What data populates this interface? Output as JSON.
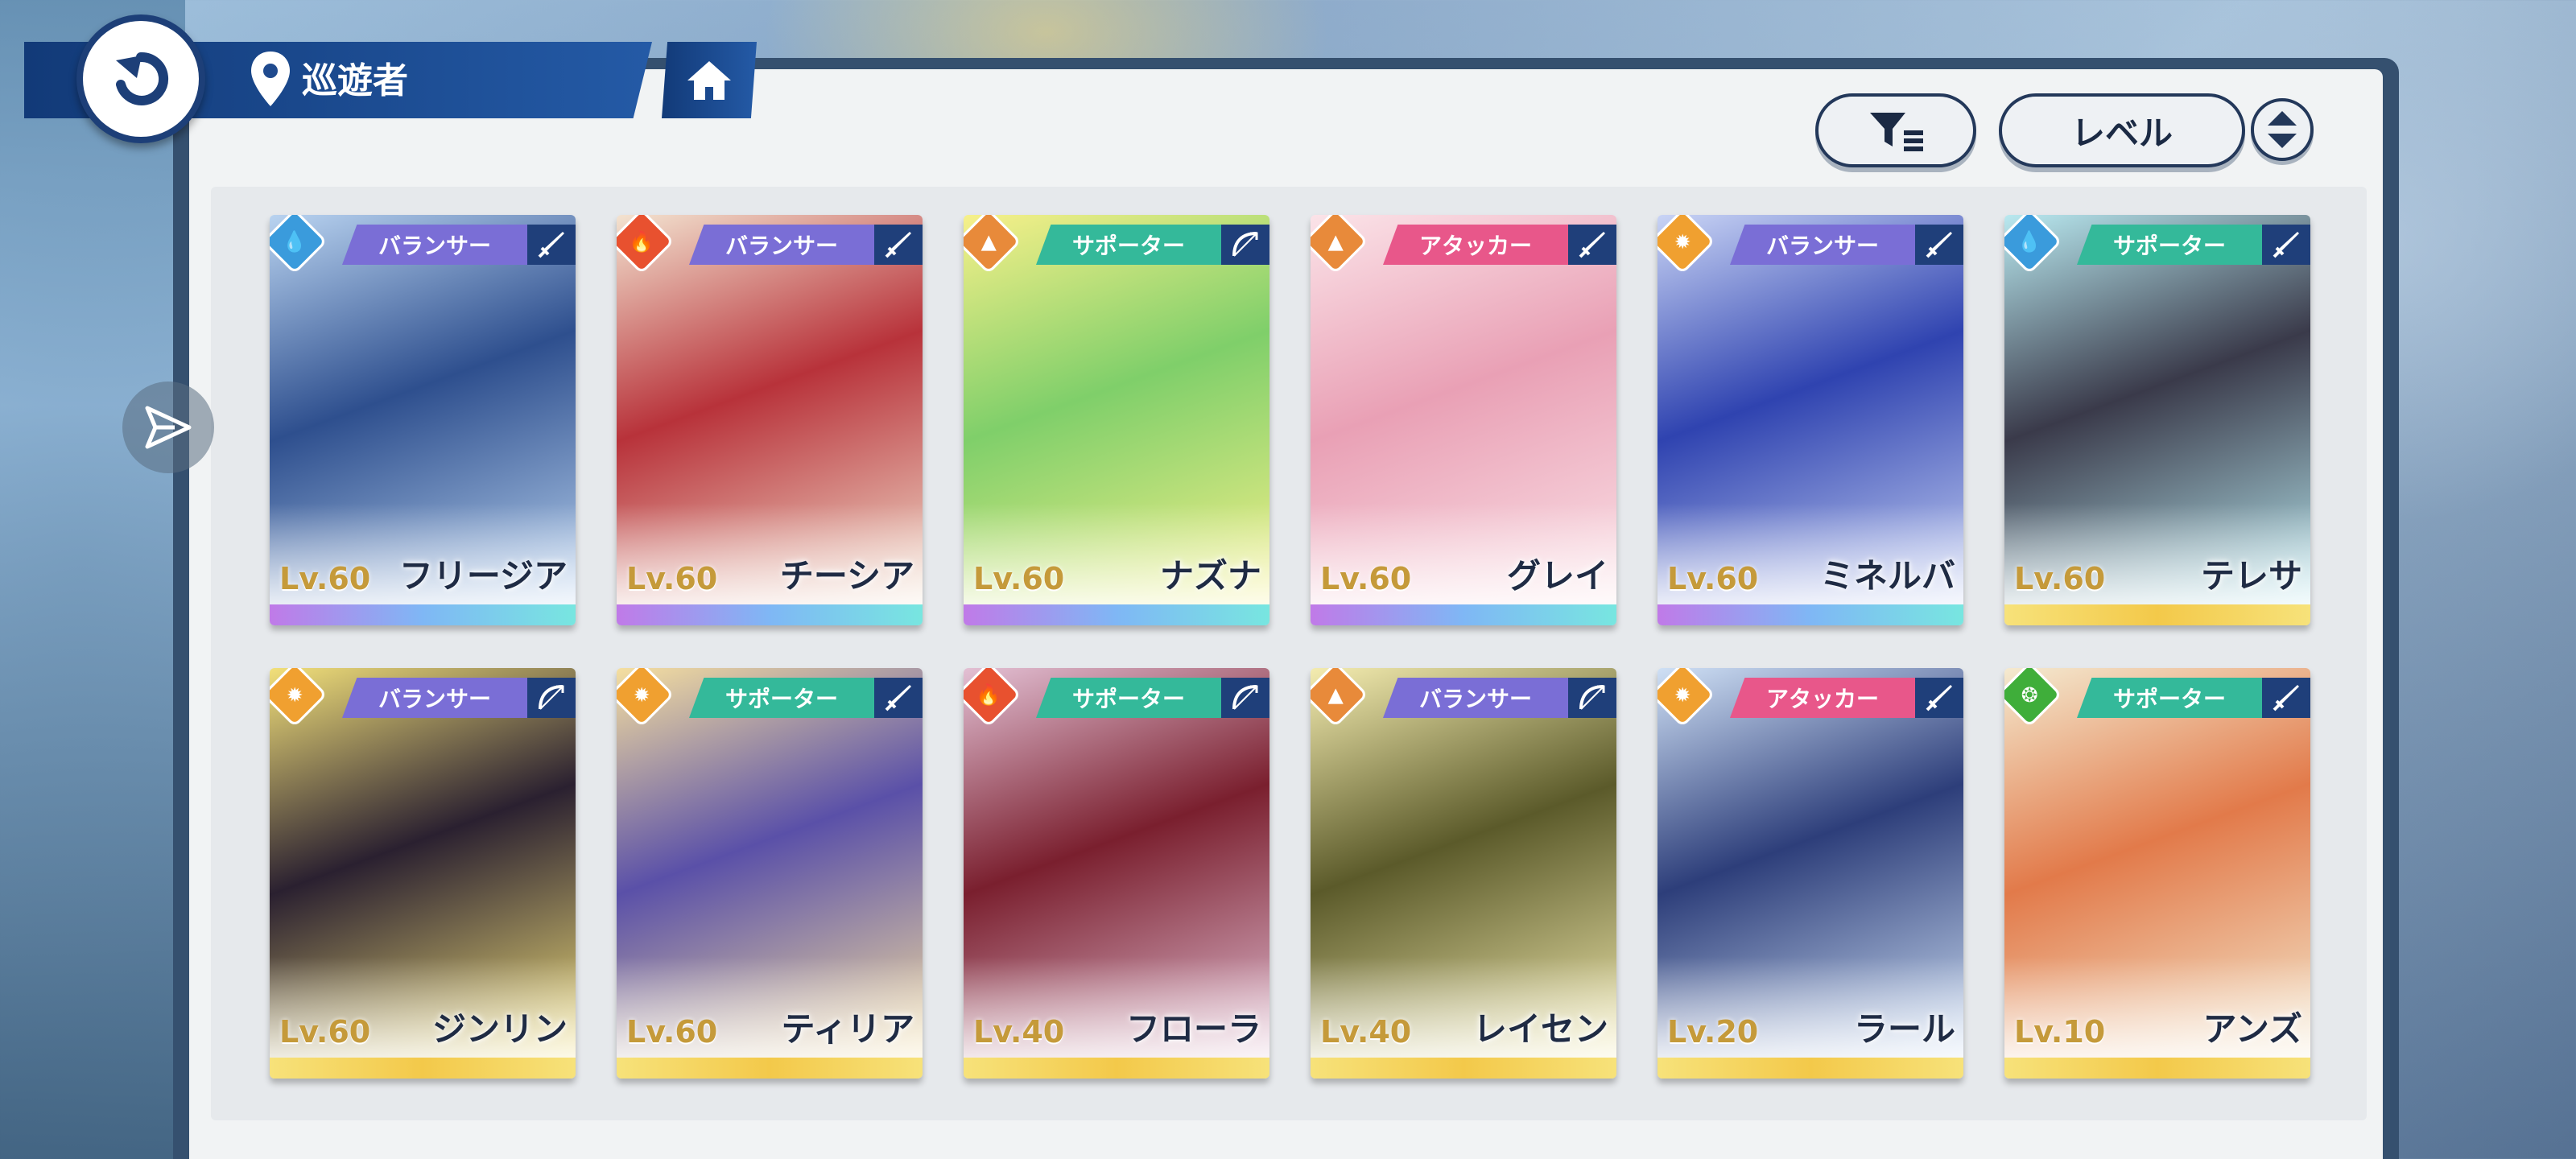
{
  "header": {
    "title": "巡遊者",
    "icons": {
      "back": "back-arrow-icon",
      "location": "location-pin-icon",
      "home": "home-icon",
      "share": "send-icon"
    }
  },
  "toolbar": {
    "filter_icon": "filter-icon",
    "sort_label": "レベル",
    "sort_order_icon": "sort-order-icon"
  },
  "colors": {
    "brand_blue": "#1d3f78",
    "role_balancer": "#7a6ed6",
    "role_supporter": "#34b99a",
    "role_attacker": "#e8578a",
    "element_water": "#3a9bdc",
    "element_fire": "#e8512f",
    "element_earth": "#e88a3a",
    "element_light": "#f0a030",
    "element_wind": "#3fae3a"
  },
  "characters": [
    {
      "name": "フリージア",
      "level": "Lv.60",
      "role": "バランサー",
      "element": "water",
      "weapon": "sword",
      "rarity_bar": "rainbow",
      "art": [
        "#2e4f8e",
        "#b9d3f0"
      ]
    },
    {
      "name": "チーシア",
      "level": "Lv.60",
      "role": "バランサー",
      "element": "fire",
      "weapon": "sword",
      "rarity_bar": "rainbow",
      "art": [
        "#b8323a",
        "#f3e3d0"
      ]
    },
    {
      "name": "ナズナ",
      "level": "Lv.60",
      "role": "サポーター",
      "element": "earth",
      "weapon": "bow",
      "rarity_bar": "rainbow",
      "art": [
        "#7fcf6a",
        "#f7f08a"
      ]
    },
    {
      "name": "グレイ",
      "level": "Lv.60",
      "role": "アタッカー",
      "element": "earth",
      "weapon": "sword",
      "rarity_bar": "rainbow",
      "art": [
        "#e9a0b5",
        "#fbe3e8"
      ]
    },
    {
      "name": "ミネルバ",
      "level": "Lv.60",
      "role": "バランサー",
      "element": "light",
      "weapon": "sword",
      "rarity_bar": "rainbow",
      "art": [
        "#2f43b0",
        "#c9d4f5"
      ]
    },
    {
      "name": "テレサ",
      "level": "Lv.60",
      "role": "サポーター",
      "element": "water",
      "weapon": "sword",
      "rarity_bar": "gold",
      "art": [
        "#3a3a4a",
        "#b9e9f0"
      ]
    },
    {
      "name": "ジンリン",
      "level": "Lv.60",
      "role": "バランサー",
      "element": "light",
      "weapon": "bow",
      "rarity_bar": "gold",
      "art": [
        "#2a2030",
        "#f2e07a"
      ]
    },
    {
      "name": "ティリア",
      "level": "Lv.60",
      "role": "サポーター",
      "element": "light",
      "weapon": "sword",
      "rarity_bar": "gold",
      "art": [
        "#5a50a8",
        "#f5dfa0"
      ]
    },
    {
      "name": "フローラ",
      "level": "Lv.40",
      "role": "サポーター",
      "element": "fire",
      "weapon": "bow",
      "rarity_bar": "gold",
      "art": [
        "#7a1f2e",
        "#e3c0d4"
      ]
    },
    {
      "name": "レイセン",
      "level": "Lv.40",
      "role": "バランサー",
      "element": "earth",
      "weapon": "bow",
      "rarity_bar": "gold",
      "art": [
        "#5b5a2a",
        "#f4ecb0"
      ]
    },
    {
      "name": "ラール",
      "level": "Lv.20",
      "role": "アタッカー",
      "element": "light",
      "weapon": "sword",
      "rarity_bar": "gold",
      "art": [
        "#2d3e7a",
        "#cfe0f5"
      ]
    },
    {
      "name": "アンズ",
      "level": "Lv.10",
      "role": "サポーター",
      "element": "wind",
      "weapon": "sword",
      "rarity_bar": "gold",
      "art": [
        "#e27a4a",
        "#f4ead0"
      ]
    }
  ]
}
